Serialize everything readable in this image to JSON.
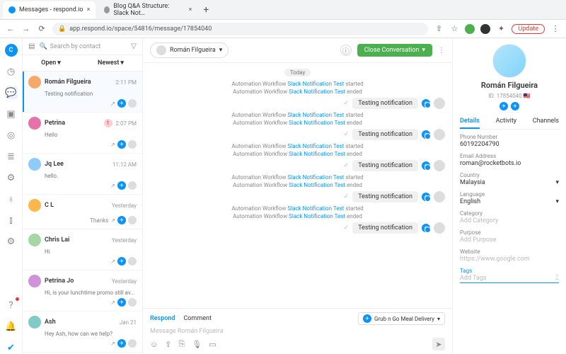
{
  "browser": {
    "tabs": [
      {
        "title": "Messages - respond.io",
        "active": true
      },
      {
        "title": "Blog Q&A Structure: Slack Not…",
        "active": false
      }
    ],
    "url": "app.respond.io/space/54816/message/17854040",
    "update_label": "Update"
  },
  "rail": {
    "user_initial": "C"
  },
  "inbox": {
    "search_placeholder": "Search by contact",
    "filter_open": "Open",
    "filter_newest": "Newest",
    "conversations": [
      {
        "name": "Román Filgueira",
        "time": "2:11 PM",
        "preview": "Testing notification",
        "selected": true,
        "av": "#f6a96b"
      },
      {
        "name": "Petrina",
        "time": "2:07 PM",
        "preview": "Hello",
        "badge": "1",
        "av": "#e573a7"
      },
      {
        "name": "Jq Lee",
        "time": "11:12 AM",
        "preview": "hello.",
        "av": "#90caf9"
      },
      {
        "name": "C L",
        "time": "Yesterday",
        "preview": "",
        "av": "#ffb74d"
      },
      {
        "name": "Chris Lai",
        "time": "Yesterday",
        "preview": "Hi",
        "av": "#a5d6a7"
      },
      {
        "name": "Petrina Jo",
        "time": "Yesterday",
        "preview": "Hi, is your lunchtime promo still available?",
        "av": "#ce93d8"
      },
      {
        "name": "Ash",
        "time": "Jan 21",
        "preview": "Hey Ash, how can we help?",
        "av": "#80cbc4"
      }
    ],
    "thanks": "Thanks"
  },
  "chat": {
    "contact_name": "Román Filgueira",
    "close_label": "Close Conversation",
    "date_label": "Today",
    "workflow_prefix": "Automation Workflow ",
    "workflow_link": "Slack Notification Test",
    "workflow_started": " started",
    "workflow_ended": " ended",
    "bubble_text": "Testing notification",
    "composer": {
      "respond_tab": "Respond",
      "comment_tab": "Comment",
      "channel": "Grub n Go Meal Delivery",
      "placeholder": "Message Román Filgueira"
    }
  },
  "details": {
    "name": "Román Filgueira",
    "id_label": "ID: 17854040 ",
    "tabs": {
      "details": "Details",
      "activity": "Activity",
      "channels": "Channels"
    },
    "fields": {
      "phone_label": "Phone Number",
      "phone_value": "60192204790",
      "email_label": "Email Address",
      "email_value": "roman@rocketbots.io",
      "country_label": "Country",
      "country_value": "Malaysia",
      "language_label": "Language",
      "language_value": "English",
      "category_label": "Category",
      "category_placeholder": "Add Category",
      "purpose_label": "Purpose",
      "purpose_placeholder": "Add Purpose",
      "website_label": "Website",
      "website_value": "https://www.google.com",
      "tags_label": "Tags",
      "tags_placeholder": "Add Tags"
    }
  }
}
